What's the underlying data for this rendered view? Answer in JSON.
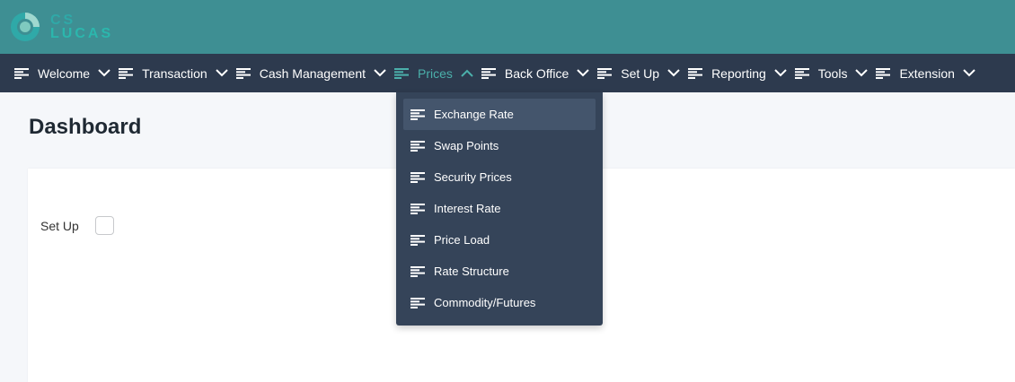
{
  "logo": {
    "line1": "CS",
    "line2": "LUCAS"
  },
  "nav": {
    "items": [
      {
        "label": "Welcome",
        "active": false
      },
      {
        "label": "Transaction",
        "active": false
      },
      {
        "label": "Cash Management",
        "active": false
      },
      {
        "label": "Prices",
        "active": true
      },
      {
        "label": "Back Office",
        "active": false
      },
      {
        "label": "Set Up",
        "active": false
      },
      {
        "label": "Reporting",
        "active": false
      },
      {
        "label": "Tools",
        "active": false
      },
      {
        "label": "Extension",
        "active": false
      }
    ]
  },
  "dropdown": {
    "items": [
      {
        "label": "Exchange Rate"
      },
      {
        "label": "Swap Points"
      },
      {
        "label": "Security Prices"
      },
      {
        "label": "Interest Rate"
      },
      {
        "label": "Price Load"
      },
      {
        "label": "Rate Structure"
      },
      {
        "label": "Commodity/Futures"
      }
    ]
  },
  "page": {
    "title": "Dashboard"
  },
  "card": {
    "setup_label": "Set Up"
  },
  "colors": {
    "header": "#3e8f93",
    "navbar": "#2d3a4e",
    "accent": "#4bb0ab",
    "dropdown": "#354459",
    "dropdown_hover": "#44556c"
  }
}
